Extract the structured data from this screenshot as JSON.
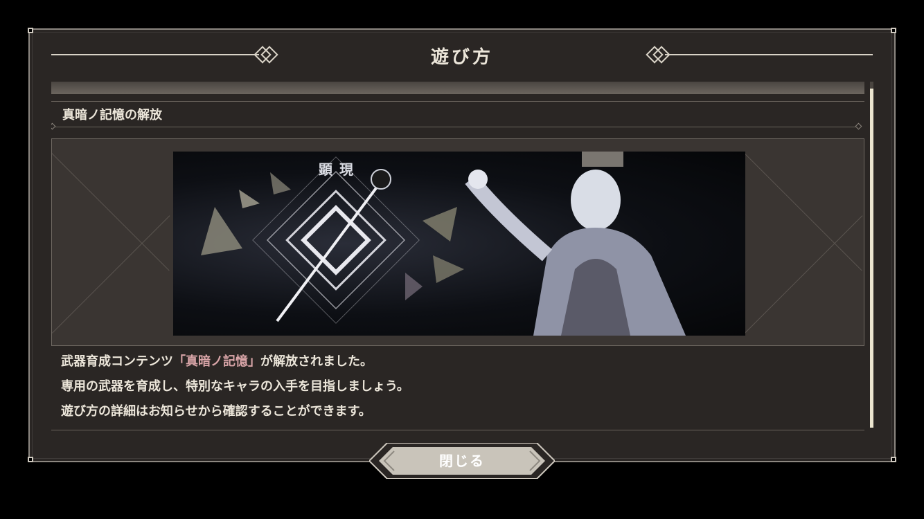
{
  "dialog": {
    "title": "遊び方",
    "section_title": "真暗ノ記憶の解放",
    "banner_label": "顕現",
    "description": {
      "line1_prefix": "武器育成コンテンツ",
      "line1_highlight": "「真暗ノ記憶」",
      "line1_suffix": "が解放されました。",
      "line2": "専用の武器を育成し、特別なキャラの入手を目指しましょう。",
      "line3": "遊び方の詳細はお知らせから確認することができます。"
    },
    "close_label": "閉じる"
  },
  "colors": {
    "background": "#000000",
    "panel": "#2a2624",
    "border": "#8c8780",
    "highlight_text": "#d9a5a8",
    "button": "#c9c4ba",
    "scrollbar_thumb": "#ebe5cf"
  }
}
